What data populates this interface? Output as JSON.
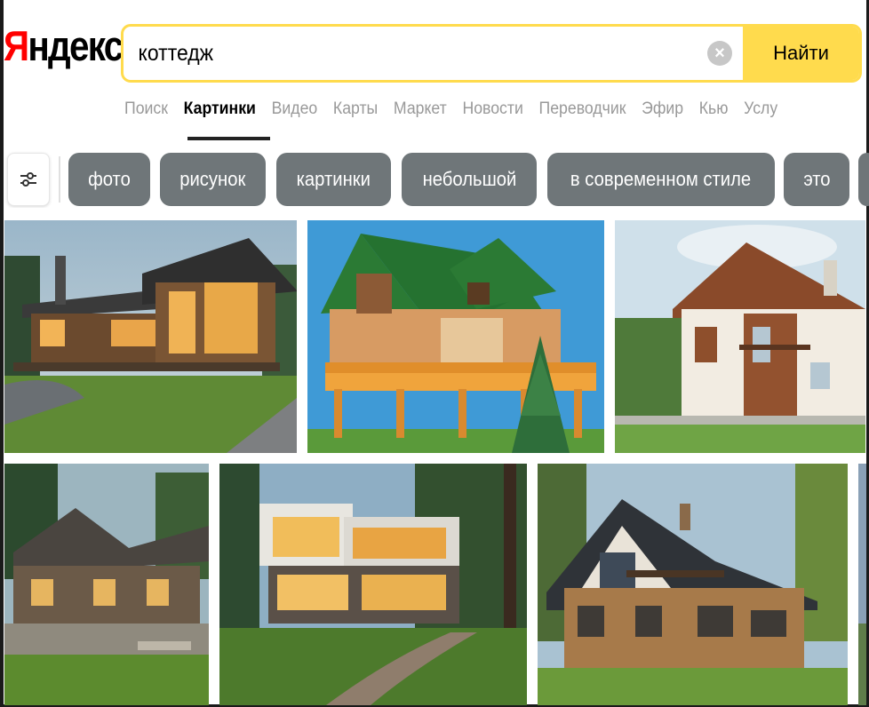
{
  "logo": {
    "first_letter": "Я",
    "rest": "ндекс"
  },
  "search": {
    "value": "коттедж",
    "button_label": "Найти"
  },
  "services": [
    {
      "label": "Поиск",
      "active": false
    },
    {
      "label": "Картинки",
      "active": true
    },
    {
      "label": "Видео",
      "active": false
    },
    {
      "label": "Карты",
      "active": false
    },
    {
      "label": "Маркет",
      "active": false
    },
    {
      "label": "Новости",
      "active": false
    },
    {
      "label": "Переводчик",
      "active": false
    },
    {
      "label": "Эфир",
      "active": false
    },
    {
      "label": "Кью",
      "active": false
    },
    {
      "label": "Услу",
      "active": false
    }
  ],
  "chips": [
    "фото",
    "рисунок",
    "картинки",
    "небольшой",
    "в современном стиле",
    "это"
  ],
  "images": [
    {
      "icon": "wooden-chalet-image"
    },
    {
      "icon": "green-roof-log-house-image"
    },
    {
      "icon": "white-brown-house-image"
    },
    {
      "icon": "stone-cottage-image"
    },
    {
      "icon": "modern-white-villa-image"
    },
    {
      "icon": "brick-chalet-image"
    },
    {
      "icon": "partial-image"
    }
  ],
  "colors": {
    "accent": "#ffdb4d",
    "logo_red": "#ff0000",
    "chip_bg": "#6f7679",
    "service_inactive": "#999999"
  }
}
